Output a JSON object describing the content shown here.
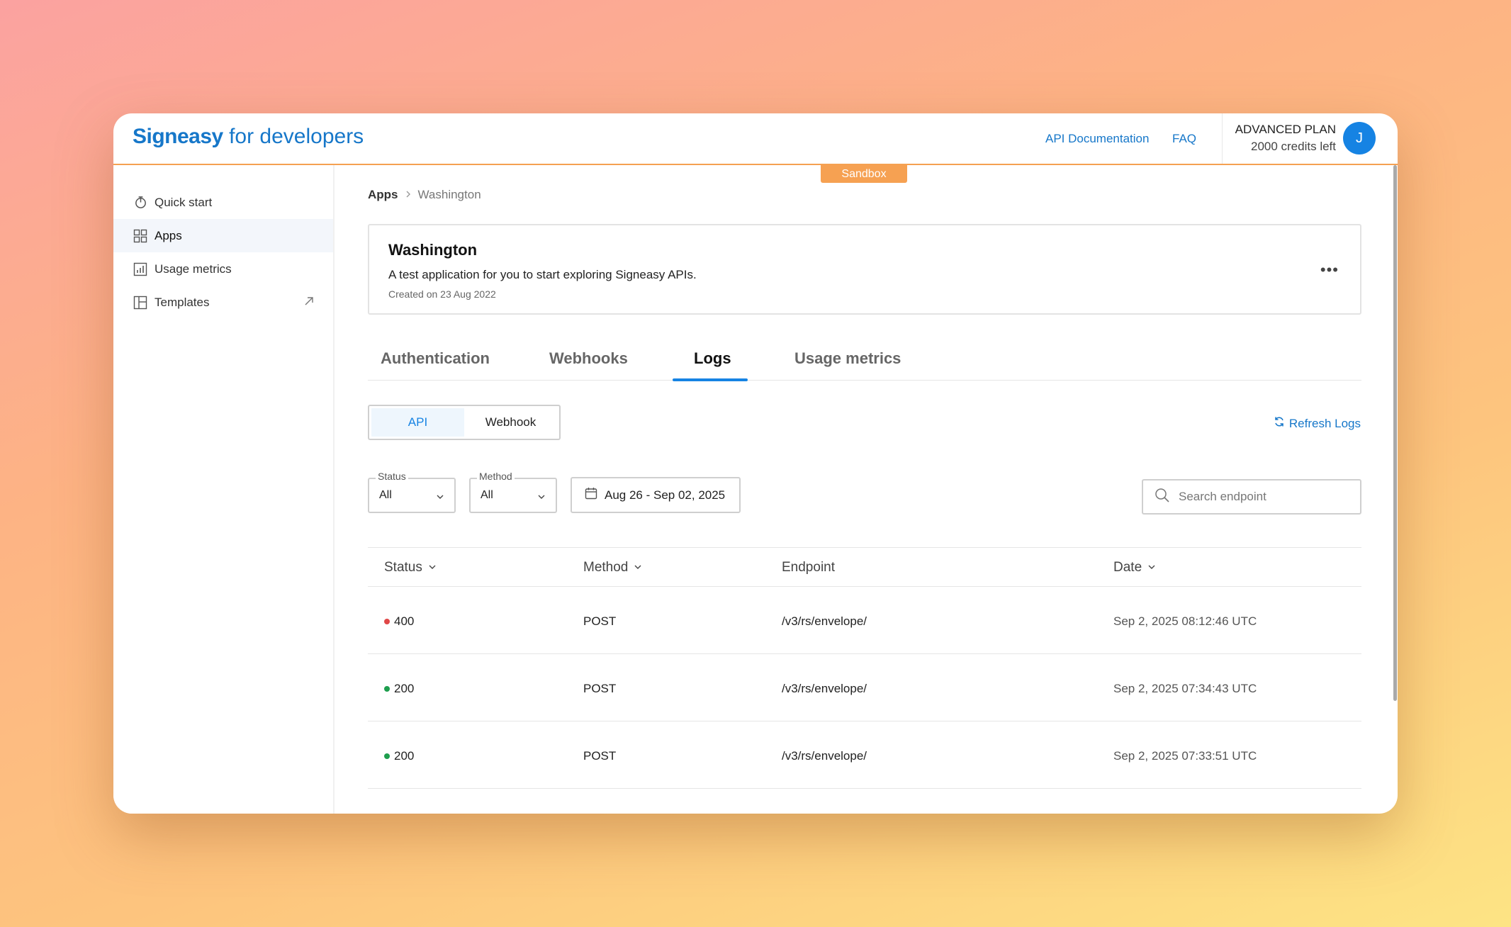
{
  "header": {
    "brand": "Signeasy",
    "brand_sub": "for developers",
    "links": {
      "api_docs": "API Documentation",
      "faq": "FAQ"
    },
    "plan": {
      "name": "ADVANCED PLAN",
      "credits": "2000 credits left"
    },
    "avatar_initial": "J",
    "environment_badge": "Sandbox"
  },
  "sidebar": {
    "items": [
      {
        "label": "Quick start",
        "icon": "power-icon"
      },
      {
        "label": "Apps",
        "icon": "grid-icon",
        "active": true
      },
      {
        "label": "Usage metrics",
        "icon": "bar-chart-icon"
      },
      {
        "label": "Templates",
        "icon": "template-icon",
        "external": true
      }
    ]
  },
  "breadcrumb": {
    "root": "Apps",
    "current": "Washington"
  },
  "app": {
    "name": "Washington",
    "description": "A test application for you to start exploring Signeasy APIs.",
    "created": "Created on 23 Aug 2022",
    "more": "•••"
  },
  "tabs": [
    {
      "label": "Authentication"
    },
    {
      "label": "Webhooks"
    },
    {
      "label": "Logs",
      "active": true
    },
    {
      "label": "Usage metrics"
    }
  ],
  "log_type": {
    "api": "API",
    "webhook": "Webhook",
    "selected": "API"
  },
  "refresh_label": "Refresh Logs",
  "filters": {
    "status": {
      "label": "Status",
      "value": "All"
    },
    "method": {
      "label": "Method",
      "value": "All"
    },
    "date_range": "Aug 26 - Sep 02, 2025"
  },
  "search": {
    "placeholder": "Search endpoint",
    "value": ""
  },
  "table": {
    "columns": {
      "status": "Status",
      "method": "Method",
      "endpoint": "Endpoint",
      "date": "Date"
    },
    "rows": [
      {
        "status": "400",
        "status_color": "#e04848",
        "method": "POST",
        "endpoint": "/v3/rs/envelope/",
        "date": "Sep 2, 2025 08:12:46 UTC"
      },
      {
        "status": "200",
        "status_color": "#1e9e4e",
        "method": "POST",
        "endpoint": "/v3/rs/envelope/",
        "date": "Sep 2, 2025 07:34:43 UTC"
      },
      {
        "status": "200",
        "status_color": "#1e9e4e",
        "method": "POST",
        "endpoint": "/v3/rs/envelope/",
        "date": "Sep 2, 2025 07:33:51 UTC"
      }
    ]
  },
  "colors": {
    "accent": "#1683e3",
    "link": "#1677c9",
    "sandbox": "#f6a152"
  }
}
